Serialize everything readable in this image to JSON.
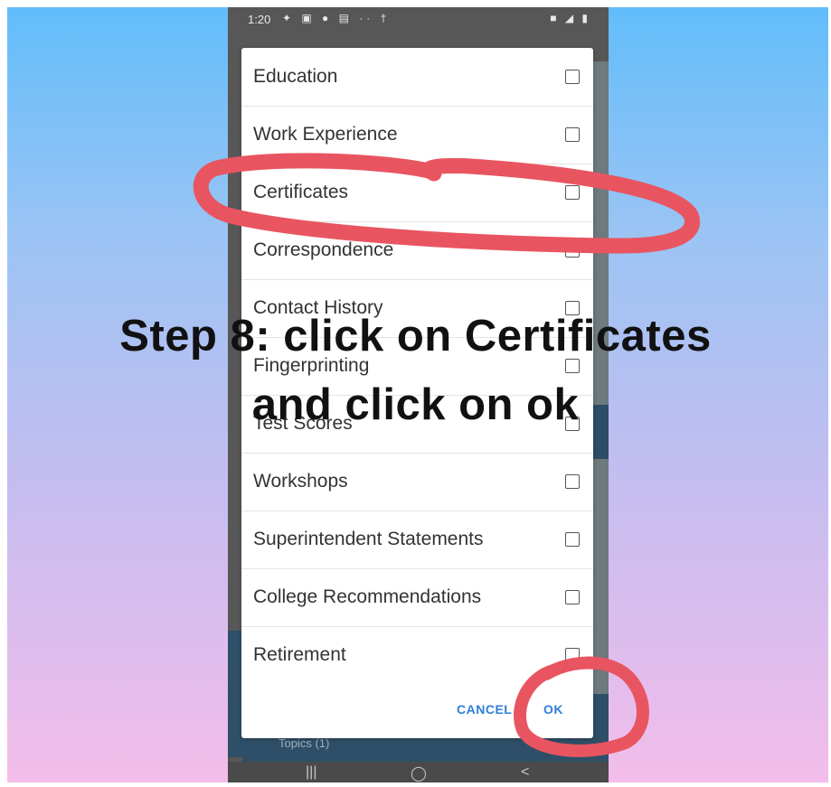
{
  "status_bar": {
    "time": "1:20",
    "left_icons": "✦ ▣ ● ▤ ·· †",
    "right_icons": "■ ◢ ▮"
  },
  "dialog": {
    "items": [
      {
        "label": "Education",
        "checked": false
      },
      {
        "label": "Work Experience",
        "checked": false
      },
      {
        "label": "Certificates",
        "checked": false
      },
      {
        "label": "Correspondence",
        "checked": false
      },
      {
        "label": "Contact History",
        "checked": false
      },
      {
        "label": "Fingerprinting",
        "checked": false
      },
      {
        "label": "Test Scores",
        "checked": false
      },
      {
        "label": "Workshops",
        "checked": false
      },
      {
        "label": "Superintendent Statements",
        "checked": false
      },
      {
        "label": "College Recommendations",
        "checked": false
      },
      {
        "label": "Retirement",
        "checked": false
      }
    ],
    "cancel_label": "CANCEL",
    "ok_label": "OK"
  },
  "background_app": {
    "bottom_label": "Topics (1)"
  },
  "nav_bar": {
    "recents": "|||",
    "home": "◯",
    "back": "<"
  },
  "overlay": {
    "line1": "Step 8: click on Certificates",
    "line2": "and click on ok"
  },
  "annotation_color": "#e85560"
}
